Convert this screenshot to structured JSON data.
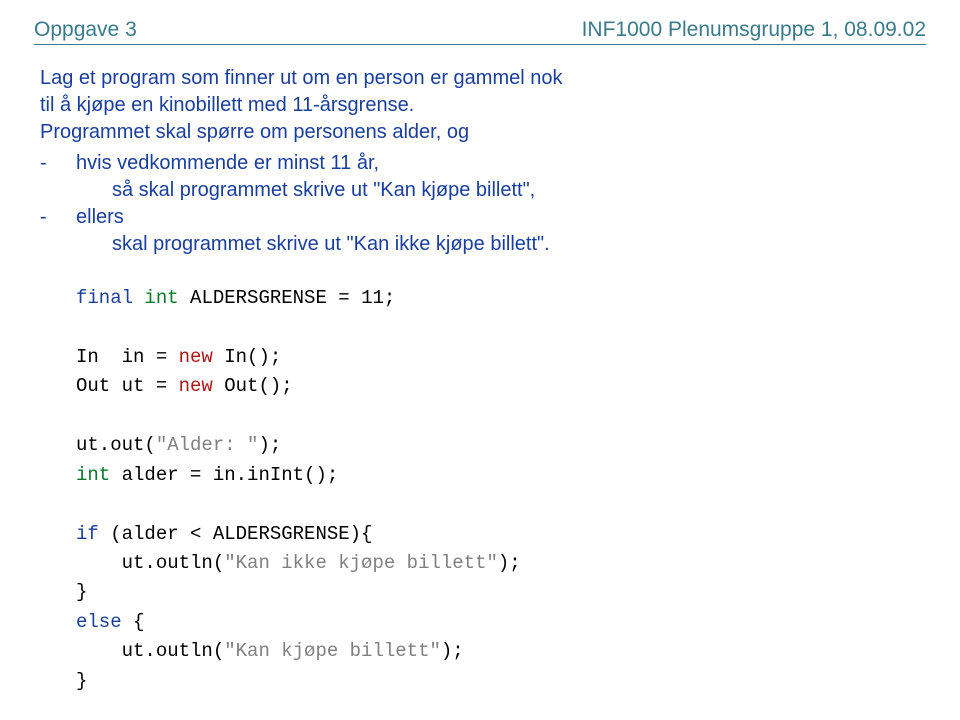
{
  "header": {
    "left": "Oppgave 3",
    "right": "INF1000  Plenumsgruppe 1, 08.09.02"
  },
  "intro": {
    "line1": "Lag et program som finner ut om en person er gammel nok",
    "line2": "til å kjøpe en kinobillett med 11-årsgrense.",
    "line3": "Programmet skal spørre om personens alder, og"
  },
  "bullets": {
    "b1": "hvis vedkommende er minst 11 år,",
    "b1sub": "så skal programmet skrive ut \"Kan kjøpe billett\",",
    "b2": "ellers",
    "b2sub": "skal programmet skrive ut \"Kan ikke kjøpe billett\"."
  },
  "code": {
    "kw_final": "final",
    "kw_int": "int",
    "const_decl": " ALDERSGRENSE = 11;",
    "in_decl_pre": "In  in = ",
    "kw_new1": "new",
    "in_decl_post": " In();",
    "out_decl_pre": "Out ut = ",
    "kw_new2": "new",
    "out_decl_post": " Out();",
    "ut_out_pre": "ut.out(",
    "str_alder": "\"Alder: \"",
    "ut_out_post": ");",
    "kw_int2": "int",
    "alder_decl": " alder = in.inInt();",
    "kw_if": "if",
    "if_cond": " (alder < ALDERSGRENSE){",
    "ut_outln1_pre": "    ut.outln(",
    "str_ikke": "\"Kan ikke kjøpe billett\"",
    "ut_outln1_post": ");",
    "close_brace1": "}",
    "kw_else": "else",
    "else_open": " {",
    "ut_outln2_pre": "    ut.outln(",
    "str_kan": "\"Kan kjøpe billett\"",
    "ut_outln2_post": ");",
    "close_brace2": "}"
  }
}
